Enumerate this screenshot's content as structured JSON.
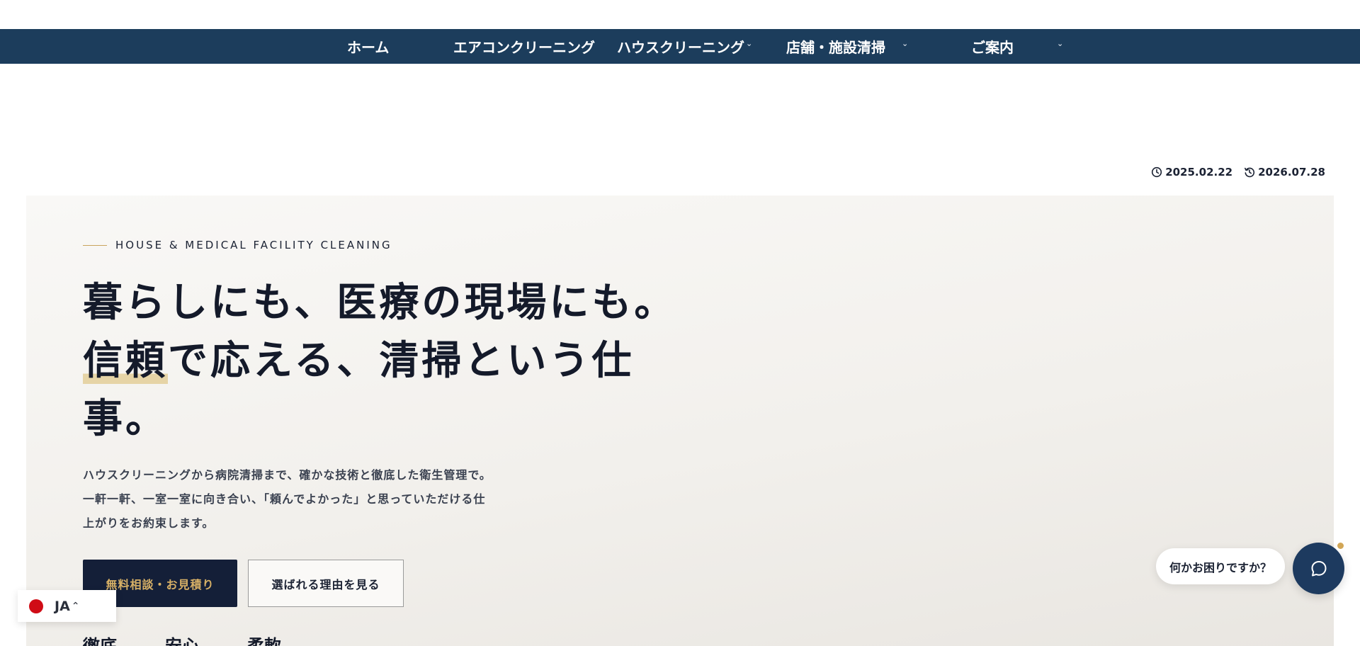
{
  "nav": {
    "items": [
      {
        "label": "ホーム",
        "dropdown": false
      },
      {
        "label": "エアコンクリーニング",
        "dropdown": false
      },
      {
        "label": "ハウスクリーニング",
        "dropdown": true
      },
      {
        "label": "店舗・施設清掃",
        "dropdown": true
      },
      {
        "label": "ご案内",
        "dropdown": true
      }
    ]
  },
  "meta": {
    "published": "2025.02.22",
    "updated": "2026.07.28"
  },
  "hero": {
    "eyebrow": "HOUSE & MEDICAL FACILITY CLEANING",
    "headline": {
      "line1": "暮らしにも、医療の現場にも。",
      "line2_mark": "信頼",
      "line2_rest": "で応える、清掃という仕",
      "line3": "事。"
    },
    "lead": [
      "ハウスクリーニングから病院清掃まで、確かな技術と徹底した衛生管理で。",
      "一軒一軒、一室一室に向き合い、「頼んでよかった」と思っていただける仕",
      "上がりをお約束します。"
    ],
    "primary_cta": "無料相談・お見積り",
    "secondary_cta": "選ばれる理由を見る",
    "pillars": [
      "徹底",
      "安心",
      "柔軟"
    ]
  },
  "language": {
    "code": "JA"
  },
  "chat": {
    "prompt": "何かお困りですか？"
  },
  "colors": {
    "nav_bg": "#1c3d5c",
    "primary_btn_bg": "#141f38",
    "primary_btn_text": "#d7b066",
    "accent": "#c9a45c",
    "chat_btn": "#1d3a5f"
  }
}
